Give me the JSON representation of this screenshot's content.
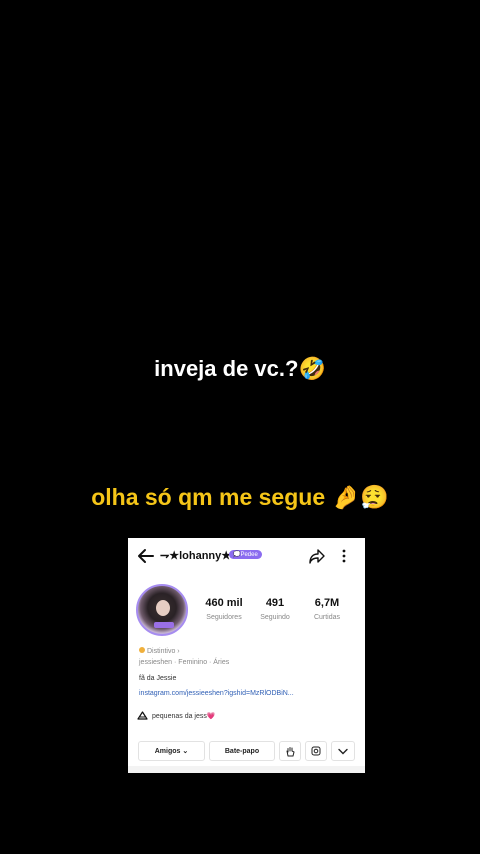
{
  "captions": {
    "line1": "inveja de vc.?🤣",
    "line2": "olha só qm me segue 🤌😮‍💨"
  },
  "profile": {
    "username": "⇁★lohanny★",
    "badge": "💭Pedee",
    "stats": [
      {
        "value": "460 mil",
        "label": "Seguidores"
      },
      {
        "value": "491",
        "label": "Seguindo"
      },
      {
        "value": "6,7M",
        "label": "Curtidas"
      }
    ],
    "distintivo": "Distintivo ›",
    "meta": "jessieshen · Feminino · Áries",
    "bio": "fã da Jessie",
    "link": "instagram.com/jessieeshen?igshid=MzRlODBiN...",
    "playlist": "pequenas da jess💗",
    "buttons": {
      "friends": "Amigos ⌄",
      "chat": "Bate-papo"
    }
  },
  "icons": {
    "back": "arrow-left-icon",
    "share": "share-icon",
    "more": "more-vertical-icon",
    "playlist": "playlist-icon",
    "wave": "hand-wave-icon",
    "instagram": "instagram-icon",
    "dropdown": "chevron-down-icon"
  },
  "colors": {
    "caption_white": "#ffffff",
    "caption_yellow": "#f5c518",
    "badge": "#8b6cf0",
    "link": "#2f5fb5"
  }
}
